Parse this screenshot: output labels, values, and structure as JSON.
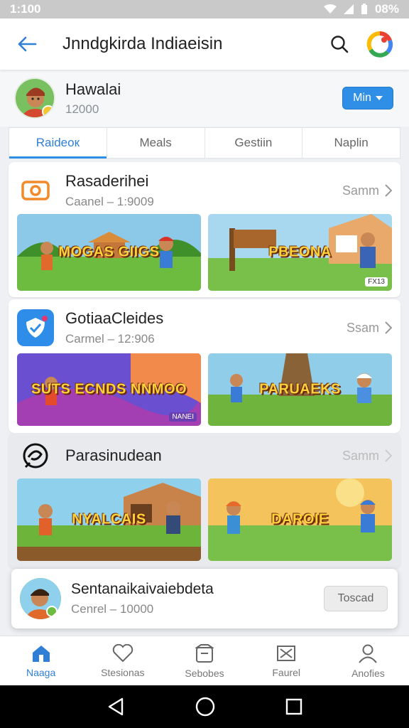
{
  "status_bar": {
    "time": "1:100",
    "battery": "08%"
  },
  "app_bar": {
    "title": "Jnndgkirda Indiaeisin"
  },
  "profile": {
    "name": "Hawalai",
    "subtitle": "12000",
    "button_label": "Min"
  },
  "tabs": [
    {
      "label": "Raidеок",
      "active": true
    },
    {
      "label": "Meals",
      "active": false
    },
    {
      "label": "Gestiin",
      "active": false
    },
    {
      "label": "Naplin",
      "active": false
    }
  ],
  "sections": [
    {
      "title": "Rasaderihei",
      "subtitle": "Caanel – 1:9009",
      "see_label": "Samm",
      "thumbs": [
        {
          "label": "MOGAS GIIGS",
          "badge": ""
        },
        {
          "label": "PBEONA",
          "badge": "FX13"
        }
      ]
    },
    {
      "title": "GotiaaCleides",
      "subtitle": "Carmel – 12:906",
      "see_label": "Ssam",
      "thumbs": [
        {
          "label": "SUTS ECNDS NNMOO",
          "badge": "NANEI"
        },
        {
          "label": "PARUAEKS",
          "badge": ""
        }
      ]
    },
    {
      "title": "Parasinudean",
      "subtitle": "",
      "see_label": "Samm",
      "thumbs": [
        {
          "label": "NYALCAIS",
          "badge": ""
        },
        {
          "label": "DAROIE",
          "badge": ""
        }
      ]
    }
  ],
  "mini_player": {
    "title": "Sentanaikaivaiebdeta",
    "subtitle": "Cenrel – 10000",
    "button_label": "Toscad"
  },
  "bottom_nav": [
    {
      "label": "Naaga",
      "icon": "home-icon",
      "active": true
    },
    {
      "label": "Stesionas",
      "icon": "heart-icon",
      "active": false
    },
    {
      "label": "Sebobes",
      "icon": "box-icon",
      "active": false
    },
    {
      "label": "Faurel",
      "icon": "mail-icon",
      "active": false
    },
    {
      "label": "Anofies",
      "icon": "user-icon",
      "active": false
    }
  ],
  "colors": {
    "accent": "#2f8fe6",
    "status_bar": "#c9c9c9"
  }
}
